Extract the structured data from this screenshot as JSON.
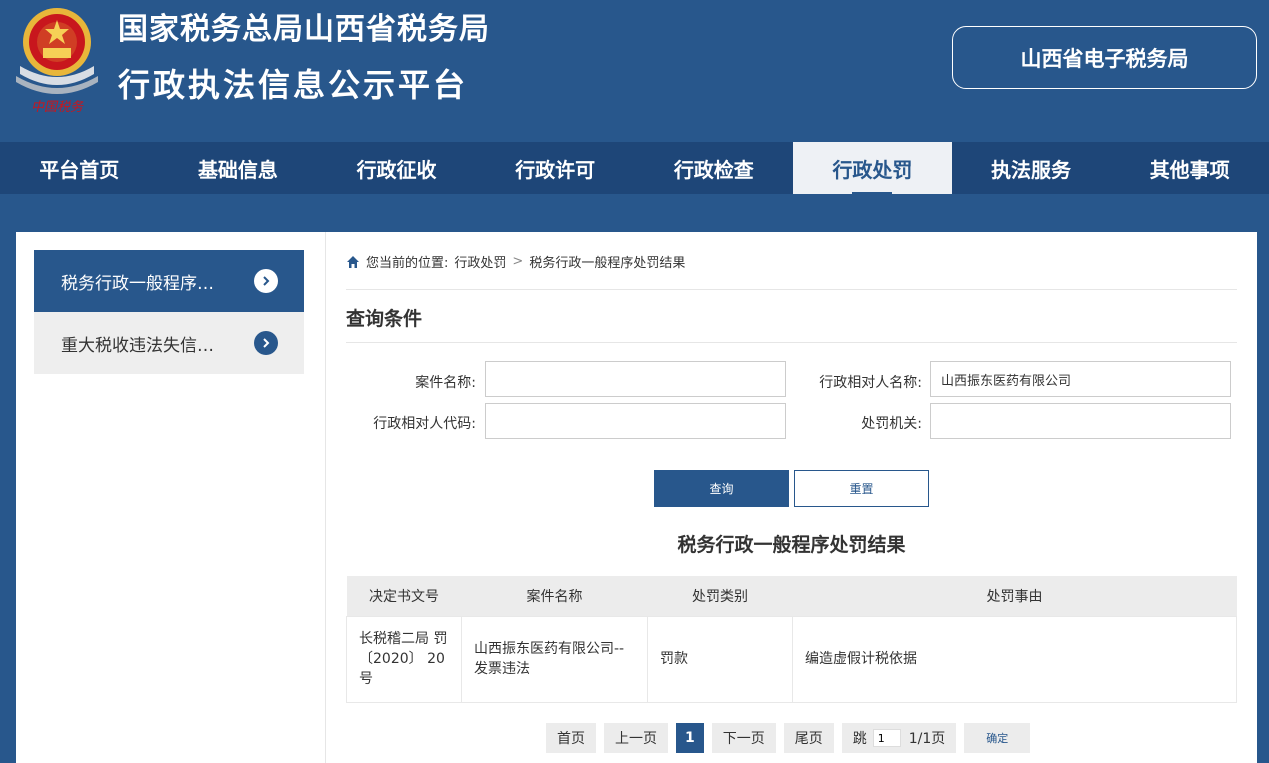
{
  "header": {
    "title_line1": "国家税务总局山西省税务局",
    "title_line2": "行政执法信息公示平台",
    "etax_button": "山西省电子税务局",
    "emblem_text": "中国税务"
  },
  "nav": {
    "items": [
      "平台首页",
      "基础信息",
      "行政征收",
      "行政许可",
      "行政检查",
      "行政处罚",
      "执法服务",
      "其他事项"
    ],
    "active_index": 5
  },
  "sidebar": {
    "items": [
      "税务行政一般程序…",
      "重大税收违法失信…"
    ],
    "active_index": 0
  },
  "breadcrumb": {
    "prefix": "您当前的位置:",
    "level1": "行政处罚",
    "separator": ">",
    "level2": "税务行政一般程序处罚结果"
  },
  "query": {
    "title": "查询条件",
    "case_name_label": "案件名称:",
    "case_name_value": "",
    "party_name_label": "行政相对人名称:",
    "party_name_value": "山西振东医药有限公司",
    "party_code_label": "行政相对人代码:",
    "party_code_value": "",
    "authority_label": "处罚机关:",
    "authority_value": "",
    "search_button": "查询",
    "reset_button": "重置"
  },
  "results": {
    "title": "税务行政一般程序处罚结果",
    "columns": [
      "决定书文号",
      "案件名称",
      "处罚类别",
      "处罚事由"
    ],
    "rows": [
      {
        "doc_no": "长税稽二局 罚〔2020〕 20号",
        "case_name": "山西振东医药有限公司--发票违法",
        "category": "罚款",
        "reason": "编造虚假计税依据"
      }
    ]
  },
  "pager": {
    "first": "首页",
    "prev": "上一页",
    "current": "1",
    "next": "下一页",
    "last": "尾页",
    "jump_label": "跳",
    "jump_value": "1",
    "total": "1/1页",
    "confirm": "确定"
  },
  "colors": {
    "primary": "#28578c",
    "nav_bg": "#1e4678",
    "emblem_red": "#c8161d",
    "emblem_gold": "#e8b63a"
  }
}
